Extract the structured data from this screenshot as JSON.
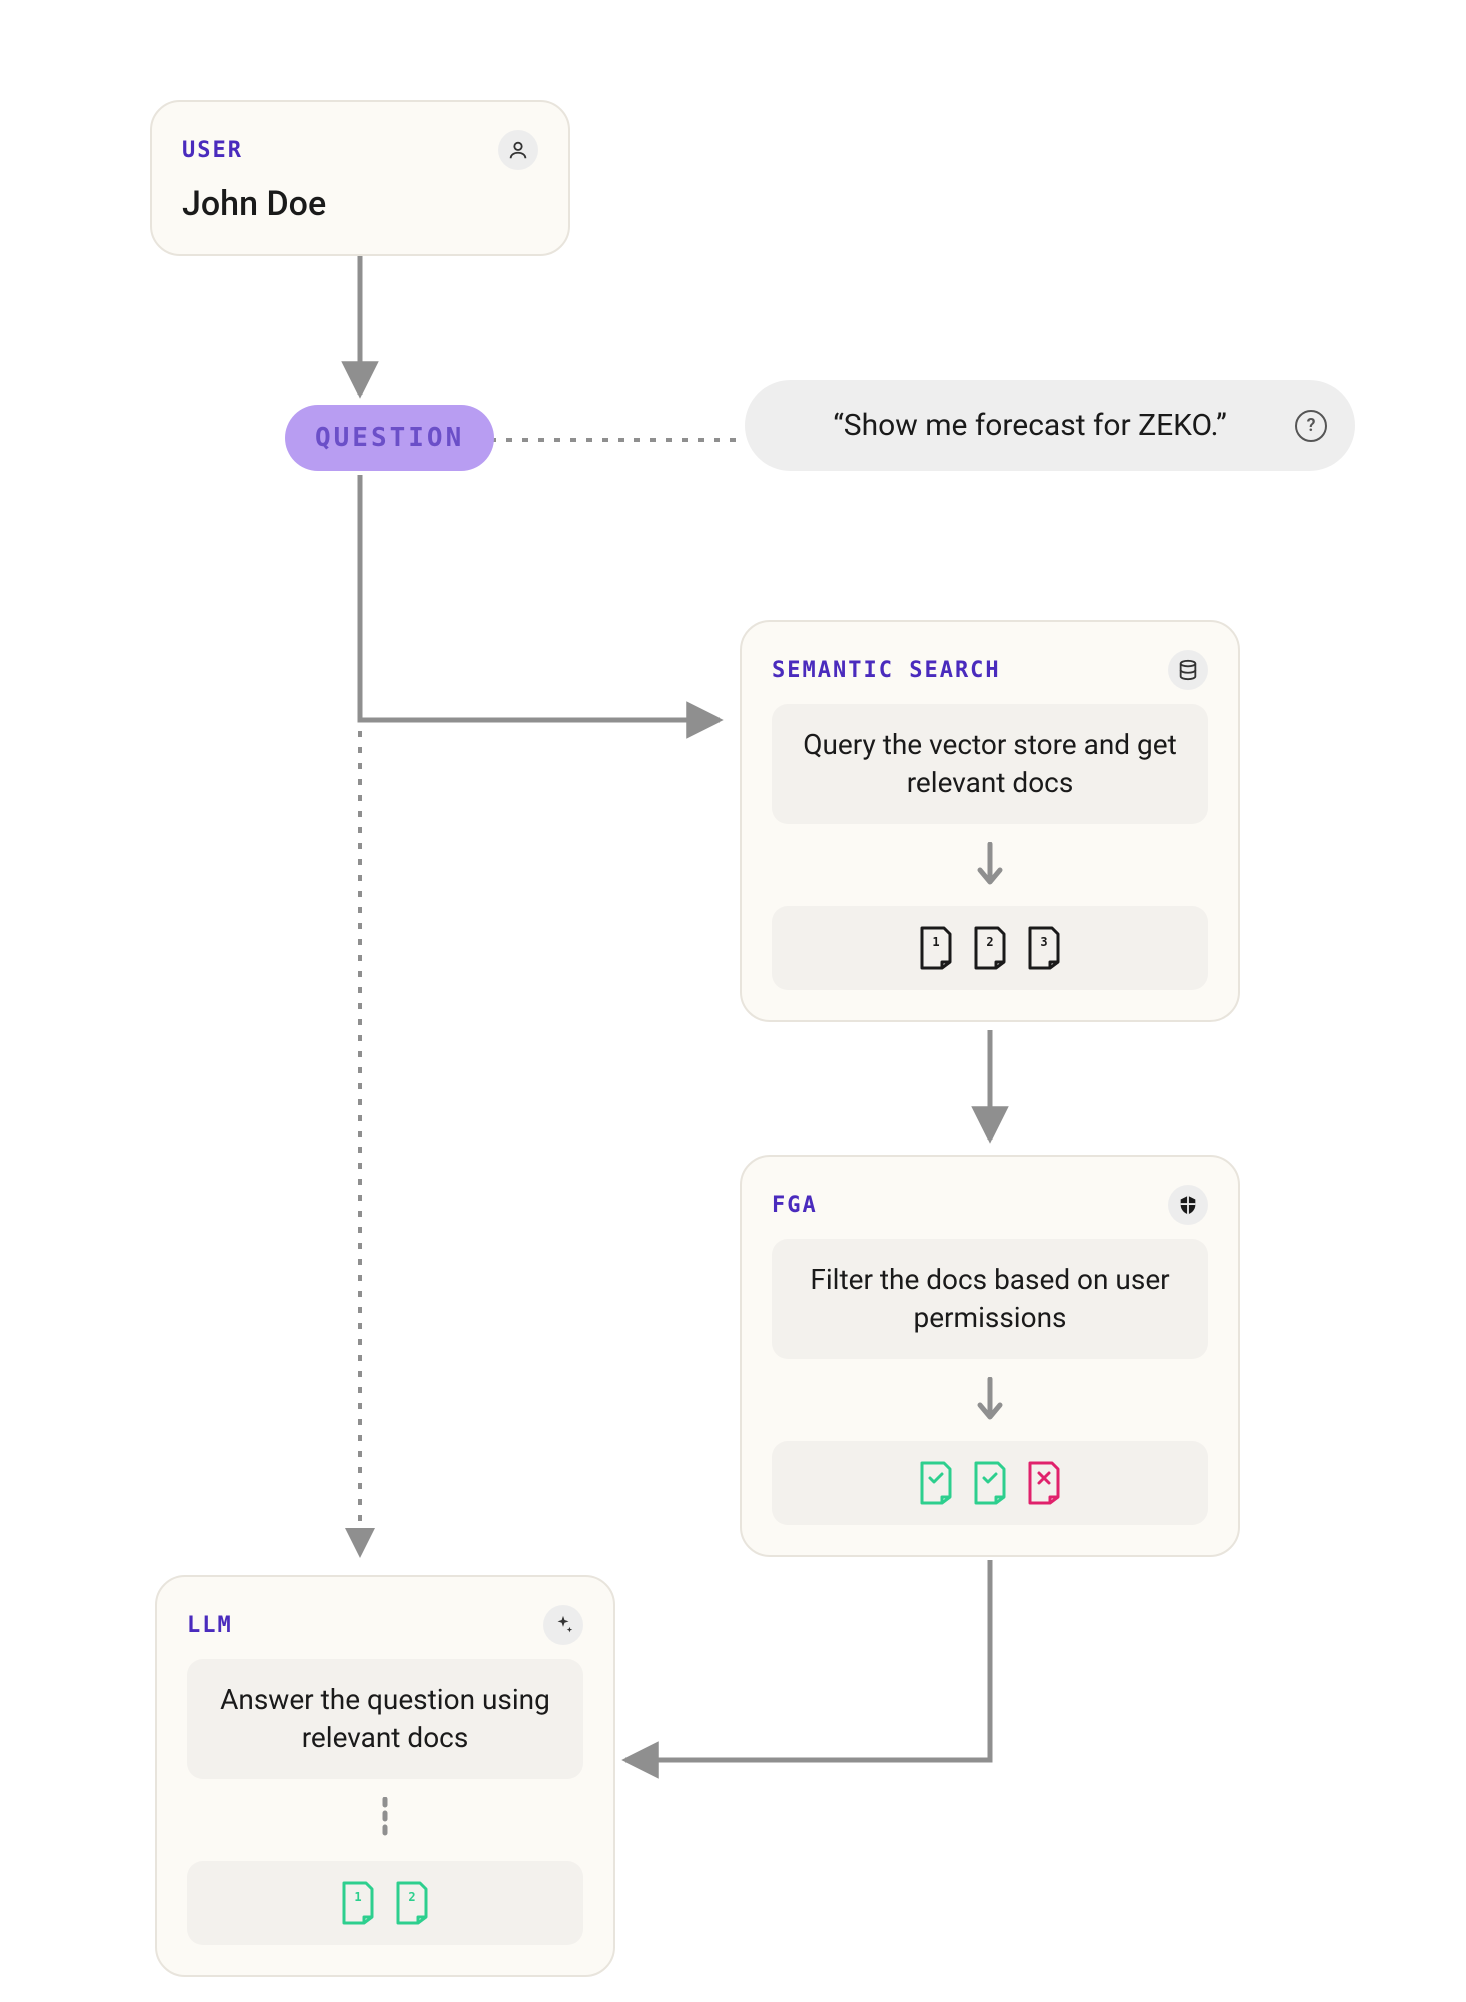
{
  "user_card": {
    "label": "USER",
    "name": "John Doe",
    "icon": "person-icon"
  },
  "question": {
    "pill_label": "QUESTION",
    "quote": "“Show me forecast for ZEKO.”",
    "help_icon_glyph": "?"
  },
  "semantic_search": {
    "label": "SEMANTIC SEARCH",
    "description": "Query the vector store and get relevant docs",
    "icon": "database-icon",
    "result_docs": [
      {
        "badge": "1",
        "status": "neutral"
      },
      {
        "badge": "2",
        "status": "neutral"
      },
      {
        "badge": "3",
        "status": "neutral"
      }
    ]
  },
  "fga": {
    "label": "FGA",
    "description": "Filter the docs based on user permissions",
    "icon": "shield-icon",
    "result_docs": [
      {
        "badge": "check",
        "status": "allowed"
      },
      {
        "badge": "check",
        "status": "allowed"
      },
      {
        "badge": "x",
        "status": "denied"
      }
    ]
  },
  "llm": {
    "label": "LLM",
    "description": "Answer the question using relevant docs",
    "icon": "sparkle-icon",
    "result_docs": [
      {
        "badge": "1",
        "status": "allowed"
      },
      {
        "badge": "2",
        "status": "allowed"
      }
    ]
  },
  "colors": {
    "purple": "#4A2BBD",
    "lavender_bg": "#B89DF2",
    "lavender_text": "#6B4FC8",
    "card_bg": "#FCFAF5",
    "card_border": "#E8E4DC",
    "inner_box_bg": "#F3F1ED",
    "arrow": "#8F8F8F",
    "allowed": "#2DCF8E",
    "denied": "#E0226C"
  }
}
